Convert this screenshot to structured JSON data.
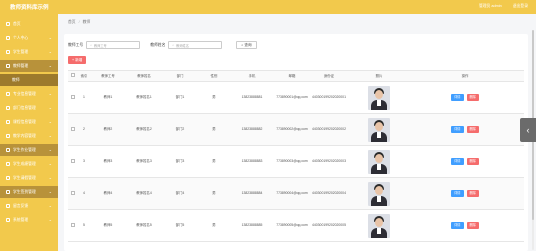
{
  "header": {
    "title": "教师资料库示例",
    "right_links": [
      "管理员 admin",
      "退出登录"
    ]
  },
  "sidebar": {
    "items": [
      {
        "label": "首页",
        "icon": "home-icon",
        "arrow": ""
      },
      {
        "label": "个人中心",
        "icon": "user-icon",
        "arrow": "⌄"
      },
      {
        "label": "学生管理",
        "icon": "student-icon",
        "arrow": "⌄"
      },
      {
        "label": "教师管理",
        "icon": "teacher-icon",
        "arrow": "⌄"
      },
      {
        "label": "教师",
        "icon": "",
        "arrow": ""
      },
      {
        "label": "专业信息管理",
        "icon": "book-icon",
        "arrow": "⌄"
      },
      {
        "label": "部门信息管理",
        "icon": "dept-icon",
        "arrow": "⌄"
      },
      {
        "label": "课程信息管理",
        "icon": "course-icon",
        "arrow": "⌄"
      },
      {
        "label": "教学内容管理",
        "icon": "content-icon",
        "arrow": "⌄"
      },
      {
        "label": "学生作业管理",
        "icon": "homework-icon",
        "arrow": "⌄"
      },
      {
        "label": "学生成绩管理",
        "icon": "grade-icon",
        "arrow": "⌄"
      },
      {
        "label": "学生请假管理",
        "icon": "leave-icon",
        "arrow": "⌄"
      },
      {
        "label": "学生签到管理",
        "icon": "sign-icon",
        "arrow": "⌄"
      },
      {
        "label": "留言反馈",
        "icon": "message-icon",
        "arrow": "⌄"
      },
      {
        "label": "系统管理",
        "icon": "system-icon",
        "arrow": "⌄"
      }
    ]
  },
  "breadcrumb": {
    "home": "首页",
    "current": "教师"
  },
  "search": {
    "no_label": "教师工号",
    "no_placeholder": "教师工号",
    "name_label": "教师姓名",
    "name_placeholder": "教师姓名",
    "button": "查询"
  },
  "add_button": "+ 新增",
  "table": {
    "headers": [
      "",
      "索引",
      "教师工号",
      "教师姓名",
      "部门",
      "性别",
      "手机",
      "邮箱",
      "身份证",
      "照片",
      "操作"
    ],
    "rows": [
      {
        "idx": "1",
        "no": "教师1",
        "name": "教师姓名1",
        "dept": "部门1",
        "sex": "男",
        "phone": "13823888881",
        "email": "773890001@qq.com",
        "id": "440300199202020001"
      },
      {
        "idx": "2",
        "no": "教师2",
        "name": "教师姓名2",
        "dept": "部门2",
        "sex": "男",
        "phone": "13823888882",
        "email": "773890002@qq.com",
        "id": "440300199202020002"
      },
      {
        "idx": "3",
        "no": "教师3",
        "name": "教师姓名3",
        "dept": "部门3",
        "sex": "男",
        "phone": "13823888883",
        "email": "773890003@qq.com",
        "id": "440300199202020003"
      },
      {
        "idx": "4",
        "no": "教师4",
        "name": "教师姓名4",
        "dept": "部门4",
        "sex": "男",
        "phone": "13823888884",
        "email": "773890004@qq.com",
        "id": "440300199202020004"
      },
      {
        "idx": "5",
        "no": "教师5",
        "name": "教师姓名5",
        "dept": "部门5",
        "sex": "男",
        "phone": "13823888885",
        "email": "773890005@qq.com",
        "id": "440300199202020005"
      }
    ],
    "view_label": "详情",
    "delete_label": "删除"
  },
  "colors": {
    "brand": "#f2c94c",
    "danger": "#f56c6c",
    "primary": "#409eff"
  }
}
